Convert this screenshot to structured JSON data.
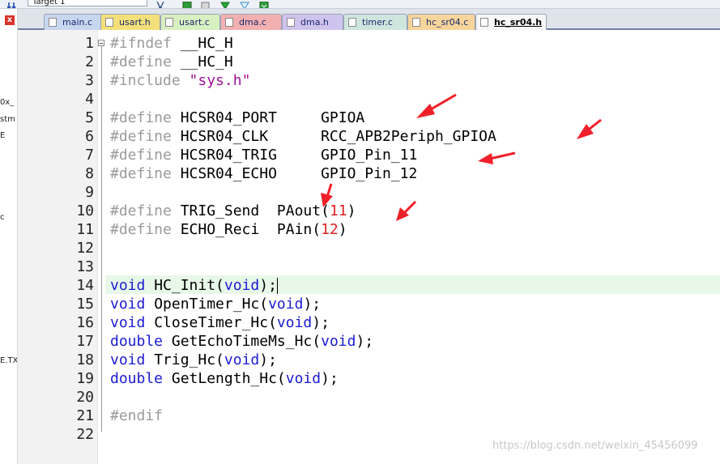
{
  "toolbar": {
    "target": "Target 1"
  },
  "left_panel": {
    "fragments": [
      "0x_",
      "stm",
      "E",
      "c",
      "E.TX"
    ]
  },
  "tabs": [
    {
      "label": "main.c",
      "color": "#c9d6f0",
      "active": false
    },
    {
      "label": "usart.h",
      "color": "#f4e07a",
      "active": false
    },
    {
      "label": "usart.c",
      "color": "#d8efc0",
      "active": false
    },
    {
      "label": "dma.c",
      "color": "#f3b0b0",
      "active": false
    },
    {
      "label": "dma.h",
      "color": "#cfc4ee",
      "active": false
    },
    {
      "label": "timer.c",
      "color": "#cfe6df",
      "active": false
    },
    {
      "label": "hc_sr04.c",
      "color": "#f7d49a",
      "active": false
    },
    {
      "label": "hc_sr04.h",
      "color": "#f7f7f7",
      "active": true
    }
  ],
  "colors": {
    "keyword": "#1b1bd4",
    "preprocessor": "#9a9a9a",
    "string": "#a0109a",
    "number": "#e02020",
    "plain": "#000000",
    "arrow": "#f0202a"
  },
  "editor": {
    "current_line": 14,
    "lines": [
      {
        "n": "1",
        "tokens": [
          {
            "t": "#ifndef",
            "c": "preprocessor"
          },
          {
            "t": " __HC_H",
            "c": "plain"
          }
        ]
      },
      {
        "n": "2",
        "tokens": [
          {
            "t": "#define",
            "c": "preprocessor"
          },
          {
            "t": " __HC_H",
            "c": "plain"
          }
        ]
      },
      {
        "n": "3",
        "tokens": [
          {
            "t": "#include",
            "c": "preprocessor"
          },
          {
            "t": " ",
            "c": "plain"
          },
          {
            "t": "\"sys.h\"",
            "c": "string"
          }
        ]
      },
      {
        "n": "4",
        "tokens": []
      },
      {
        "n": "5",
        "tokens": [
          {
            "t": "#define",
            "c": "preprocessor"
          },
          {
            "t": " HCSR04_PORT     GPIOA",
            "c": "plain"
          }
        ]
      },
      {
        "n": "6",
        "tokens": [
          {
            "t": "#define",
            "c": "preprocessor"
          },
          {
            "t": " HCSR04_CLK      RCC_APB2Periph_GPIOA",
            "c": "plain"
          }
        ]
      },
      {
        "n": "7",
        "tokens": [
          {
            "t": "#define",
            "c": "preprocessor"
          },
          {
            "t": " HCSR04_TRIG     GPIO_Pin_11",
            "c": "plain"
          }
        ]
      },
      {
        "n": "8",
        "tokens": [
          {
            "t": "#define",
            "c": "preprocessor"
          },
          {
            "t": " HCSR04_ECHO     GPIO_Pin_12",
            "c": "plain"
          }
        ]
      },
      {
        "n": "9",
        "tokens": []
      },
      {
        "n": "10",
        "tokens": [
          {
            "t": "#define",
            "c": "preprocessor"
          },
          {
            "t": " TRIG_Send  PAout(",
            "c": "plain"
          },
          {
            "t": "11",
            "c": "number"
          },
          {
            "t": ")",
            "c": "plain"
          }
        ]
      },
      {
        "n": "11",
        "tokens": [
          {
            "t": "#define",
            "c": "preprocessor"
          },
          {
            "t": " ECHO_Reci  PAin(",
            "c": "plain"
          },
          {
            "t": "12",
            "c": "number"
          },
          {
            "t": ")",
            "c": "plain"
          }
        ]
      },
      {
        "n": "12",
        "tokens": []
      },
      {
        "n": "13",
        "tokens": []
      },
      {
        "n": "14",
        "tokens": [
          {
            "t": "void",
            "c": "keyword"
          },
          {
            "t": " HC_Init(",
            "c": "plain"
          },
          {
            "t": "void",
            "c": "keyword"
          },
          {
            "t": ");",
            "c": "plain"
          }
        ]
      },
      {
        "n": "15",
        "tokens": [
          {
            "t": "void",
            "c": "keyword"
          },
          {
            "t": " OpenTimer_Hc(",
            "c": "plain"
          },
          {
            "t": "void",
            "c": "keyword"
          },
          {
            "t": ");",
            "c": "plain"
          }
        ]
      },
      {
        "n": "16",
        "tokens": [
          {
            "t": "void",
            "c": "keyword"
          },
          {
            "t": " CloseTimer_Hc(",
            "c": "plain"
          },
          {
            "t": "void",
            "c": "keyword"
          },
          {
            "t": ");",
            "c": "plain"
          }
        ]
      },
      {
        "n": "17",
        "tokens": [
          {
            "t": "double",
            "c": "keyword"
          },
          {
            "t": " GetEchoTimeMs_Hc(",
            "c": "plain"
          },
          {
            "t": "void",
            "c": "keyword"
          },
          {
            "t": ");",
            "c": "plain"
          }
        ]
      },
      {
        "n": "18",
        "tokens": [
          {
            "t": "void",
            "c": "keyword"
          },
          {
            "t": " Trig_Hc(",
            "c": "plain"
          },
          {
            "t": "void",
            "c": "keyword"
          },
          {
            "t": ");",
            "c": "plain"
          }
        ]
      },
      {
        "n": "19",
        "tokens": [
          {
            "t": "double",
            "c": "keyword"
          },
          {
            "t": " GetLength_Hc(",
            "c": "plain"
          },
          {
            "t": "void",
            "c": "keyword"
          },
          {
            "t": ");",
            "c": "plain"
          }
        ]
      },
      {
        "n": "20",
        "tokens": []
      },
      {
        "n": "21",
        "tokens": [
          {
            "t": "#endif",
            "c": "preprocessor"
          }
        ]
      },
      {
        "n": "22",
        "tokens": []
      }
    ]
  },
  "watermark": "https://blog.csdn.net/weixin_45456099"
}
